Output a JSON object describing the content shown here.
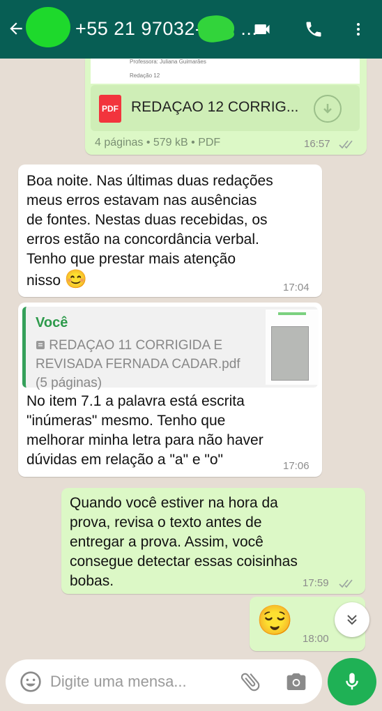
{
  "header": {
    "contact": "+55 21 97032-",
    "contact_suffix": "...",
    "icons": [
      "back-arrow-icon",
      "video-call-icon",
      "phone-icon",
      "more-vert-icon"
    ]
  },
  "preview": {
    "line1": "Professora: Juliana Guimarães",
    "line2": "Redação 12"
  },
  "messages": {
    "m1": {
      "file_icon_label": "PDF",
      "file_name": "REDAÇAO 12 CORRIG...",
      "meta": "4 páginas • 579 kB • PDF",
      "time": "16:57"
    },
    "m2": {
      "lines": [
        "Boa noite. Nas últimas duas redações",
        "meus erros estavam nas ausências",
        "de fontes. Nestas duas recebidas, os",
        "erros estão na concordância verbal.",
        "Tenho que prestar mais atenção",
        "nisso"
      ],
      "emoji": "😊",
      "time": "17:04"
    },
    "m3": {
      "quote_author": "Você",
      "quote_file_line1": "REDAÇAO 11 CORRIGIDA E",
      "quote_file_line2": "REVISADA FERNADA CADAR.pdf",
      "quote_file_line3": "(5 páginas)",
      "lines": [
        "No item 7.1 a palavra está escrita",
        "\"inúmeras\" mesmo. Tenho que",
        "melhorar minha letra para não haver",
        "dúvidas em relação a \"a\" e \"o\""
      ],
      "time": "17:06"
    },
    "m4": {
      "lines": [
        "Quando você estiver na hora da",
        "prova, revisa o texto antes de",
        "entregar a prova.  Assim, você",
        "consegue detectar essas coisinhas",
        "bobas."
      ],
      "time": "17:59"
    },
    "m5": {
      "emoji": "😌",
      "time": "18:00"
    }
  },
  "input": {
    "placeholder": "Digite uma mensa..."
  },
  "colors": {
    "header": "#075e54",
    "outgoing": "#dcf8c6",
    "incoming": "#ffffff",
    "accent": "#1fb155",
    "ticks": "#9aa4a0"
  }
}
